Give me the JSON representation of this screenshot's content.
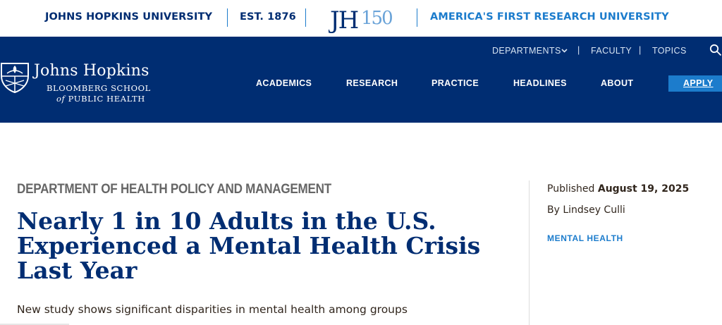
{
  "topbar": {
    "university": "JOHNS HOPKINS UNIVERSITY",
    "established": "EST. 1876",
    "anniversary_logo": "JH150",
    "tagline": "AMERICA'S FIRST RESEARCH UNIVERSITY"
  },
  "header": {
    "logo": {
      "main": "Johns Hopkins",
      "line1": "BLOOMBERG SCHOOL",
      "line2_of": "of",
      "line2": "PUBLIC HEALTH"
    },
    "utility_nav": [
      {
        "label": "DEPARTMENTS",
        "icon": "chevron-down-icon"
      },
      {
        "label": "FACULTY"
      },
      {
        "label": "TOPICS"
      }
    ],
    "main_nav": [
      "ACADEMICS",
      "RESEARCH",
      "PRACTICE",
      "HEADLINES",
      "ABOUT"
    ],
    "apply_label": "APPLY",
    "search_icon": "search-icon"
  },
  "article": {
    "department": "DEPARTMENT OF HEALTH POLICY AND MANAGEMENT",
    "title": "Nearly 1 in 10 Adults in the U.S. Experienced a Mental Health Crisis Last Year",
    "subtitle": "New study shows significant disparities in mental health among groups",
    "published_label": "Published",
    "published_date": "August 19, 2025",
    "byline": "By Lindsey Culli",
    "tag": "MENTAL HEALTH"
  },
  "colors": {
    "navy": "#002d72",
    "accent_blue": "#1c7ccc",
    "gray_heading": "#666666"
  }
}
